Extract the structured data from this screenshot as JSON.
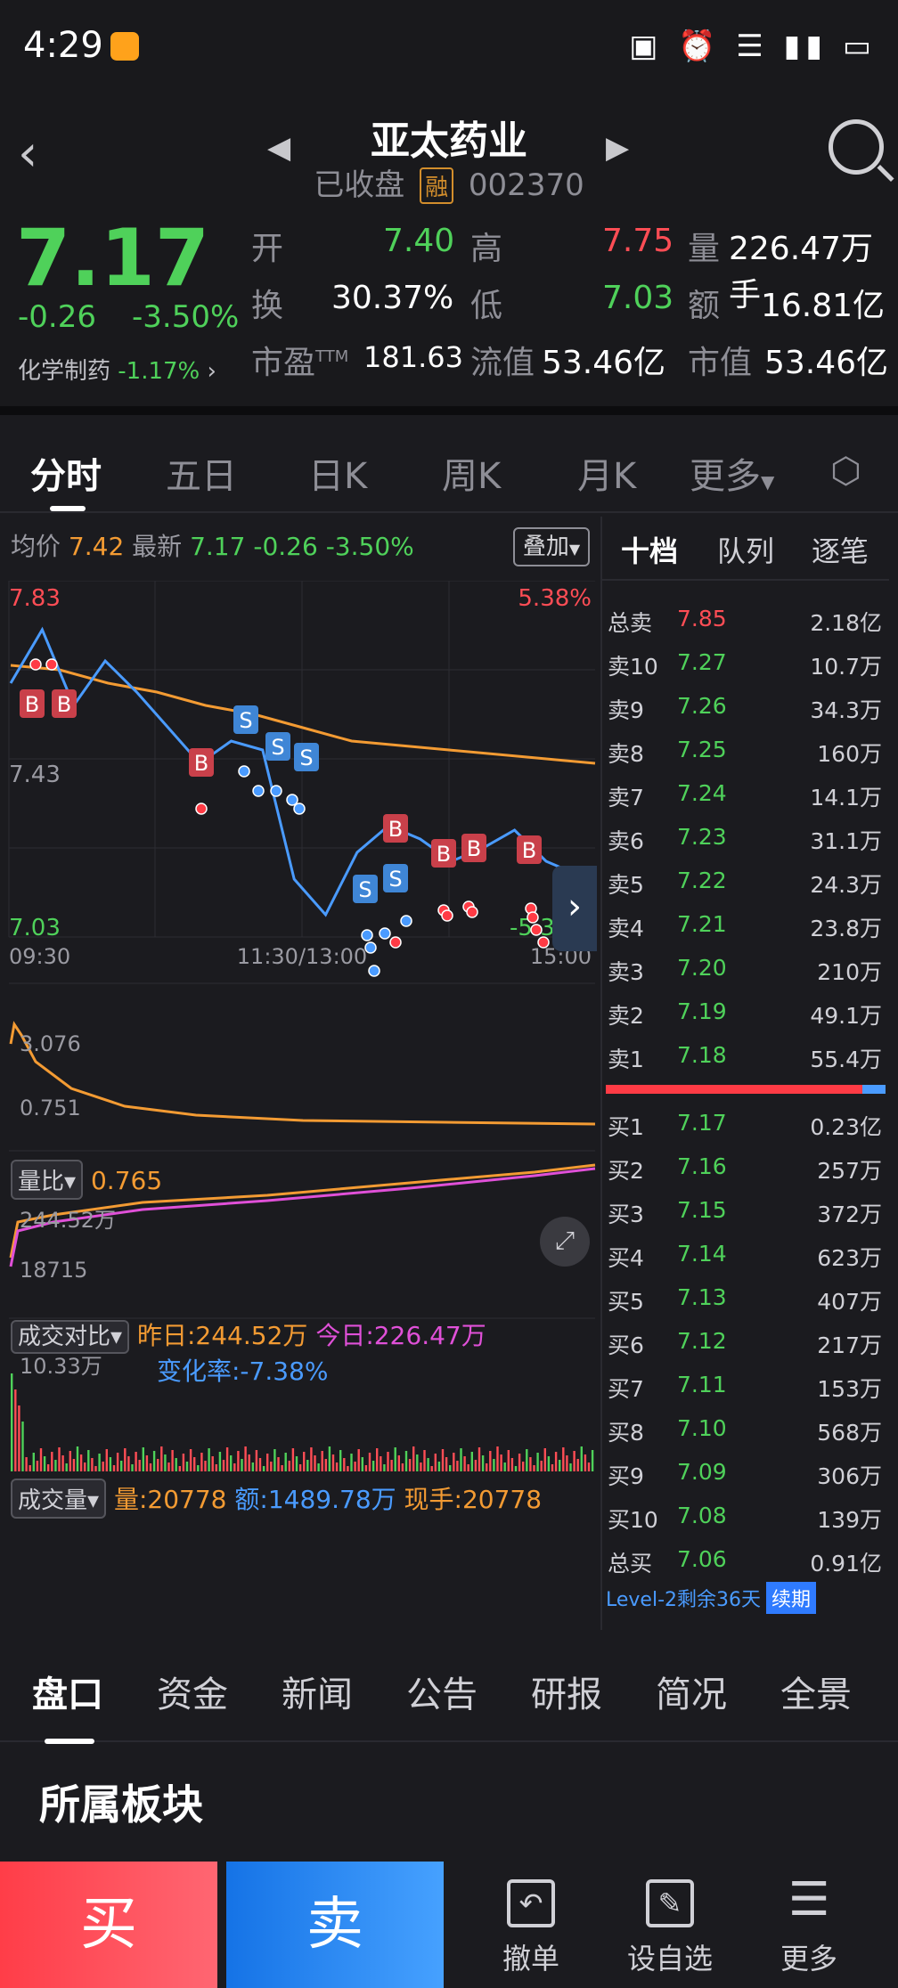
{
  "status": {
    "time": "4:29",
    "battery": "9"
  },
  "header": {
    "title": "亚太药业",
    "state": "已收盘",
    "margin_tag": "融",
    "code": "002370"
  },
  "quote": {
    "price": "7.17",
    "change": "-0.26",
    "change_pct": "-3.50%",
    "sector": "化学制药",
    "sector_pct": "-1.17%",
    "open_label": "开",
    "open": "7.40",
    "high_label": "高",
    "high": "7.75",
    "vol_label": "量",
    "vol": "226.47万手",
    "turnover_label": "换",
    "turnover": "30.37%",
    "low_label": "低",
    "low": "7.03",
    "amount_label": "额",
    "amount": "16.81亿",
    "pe_label": "市盈",
    "pe_sup": "TTM",
    "pe": "181.63",
    "float_label": "流值",
    "float_val": "53.46亿",
    "mcap_label": "市值",
    "mcap": "53.46亿"
  },
  "tabs": [
    "分时",
    "五日",
    "日K",
    "周K",
    "月K",
    "更多"
  ],
  "chart": {
    "avg_label": "均价",
    "avg": "7.42",
    "latest_label": "最新",
    "latest": "7.17",
    "latest_chg": "-0.26",
    "latest_pct": "-3.50%",
    "overlay": "叠加",
    "y_top": "7.83",
    "y_mid": "7.43",
    "y_bot": "7.03",
    "pct_top": "5.38%",
    "pct_bot": "-5.38%",
    "t_start": "09:30",
    "t_mid": "11:30/13:00",
    "t_end": "15:00",
    "vr_label": "量比",
    "vr": "0.765",
    "vr_top": "3.076",
    "vr_bot": "0.751",
    "cmp_label": "成交对比",
    "yest": "昨日:244.52万",
    "today": "今日:226.47万",
    "change_rate": "变化率:-7.38%",
    "cmp_top": "244.52万",
    "cmp_bot": "18715",
    "vol_label": "成交量",
    "vol": "量:20778",
    "amt": "额:1489.78万",
    "cur": "现手:20778",
    "vol_top": "10.33万"
  },
  "chart_data": {
    "type": "line",
    "x": [
      "09:30",
      "11:30/13:00",
      "15:00"
    ],
    "ylim": [
      7.03,
      7.83
    ],
    "series": [
      {
        "name": "均价",
        "values": [
          7.64,
          7.63,
          7.6,
          7.58,
          7.55,
          7.53,
          7.5,
          7.47,
          7.46,
          7.45,
          7.44,
          7.43,
          7.42
        ]
      },
      {
        "name": "最新",
        "values": [
          7.6,
          7.72,
          7.55,
          7.65,
          7.58,
          7.5,
          7.42,
          7.47,
          7.45,
          7.16,
          7.08,
          7.22,
          7.28,
          7.25,
          7.2,
          7.23,
          7.27,
          7.2,
          7.17
        ]
      }
    ]
  },
  "book": {
    "tabs": [
      "十档",
      "队列",
      "逐笔"
    ],
    "sells": [
      {
        "label": "总卖",
        "price": "7.85",
        "vol": "2.18亿"
      },
      {
        "label": "卖10",
        "price": "7.27",
        "vol": "10.7万"
      },
      {
        "label": "卖9",
        "price": "7.26",
        "vol": "34.3万"
      },
      {
        "label": "卖8",
        "price": "7.25",
        "vol": "160万"
      },
      {
        "label": "卖7",
        "price": "7.24",
        "vol": "14.1万"
      },
      {
        "label": "卖6",
        "price": "7.23",
        "vol": "31.1万"
      },
      {
        "label": "卖5",
        "price": "7.22",
        "vol": "24.3万"
      },
      {
        "label": "卖4",
        "price": "7.21",
        "vol": "23.8万"
      },
      {
        "label": "卖3",
        "price": "7.20",
        "vol": "210万"
      },
      {
        "label": "卖2",
        "price": "7.19",
        "vol": "49.1万"
      },
      {
        "label": "卖1",
        "price": "7.18",
        "vol": "55.4万"
      }
    ],
    "buys": [
      {
        "label": "买1",
        "price": "7.17",
        "vol": "0.23亿"
      },
      {
        "label": "买2",
        "price": "7.16",
        "vol": "257万"
      },
      {
        "label": "买3",
        "price": "7.15",
        "vol": "372万"
      },
      {
        "label": "买4",
        "price": "7.14",
        "vol": "623万"
      },
      {
        "label": "买5",
        "price": "7.13",
        "vol": "407万"
      },
      {
        "label": "买6",
        "price": "7.12",
        "vol": "217万"
      },
      {
        "label": "买7",
        "price": "7.11",
        "vol": "153万"
      },
      {
        "label": "买8",
        "price": "7.10",
        "vol": "568万"
      },
      {
        "label": "买9",
        "price": "7.09",
        "vol": "306万"
      },
      {
        "label": "买10",
        "price": "7.08",
        "vol": "139万"
      },
      {
        "label": "总买",
        "price": "7.06",
        "vol": "0.91亿"
      }
    ],
    "level2": "Level-2剩余36天",
    "renew": "续期"
  },
  "bottom_tabs": [
    "盘口",
    "资金",
    "新闻",
    "公告",
    "研报",
    "简况",
    "全景"
  ],
  "board_title": "所属板块",
  "actions": {
    "buy": "买",
    "sell": "卖",
    "cancel": "撤单",
    "watch": "设自选",
    "more": "更多"
  },
  "colors": {
    "up": "#ff4d55",
    "down": "#4fd15a",
    "avg": "#f39b33",
    "line": "#4a9bff"
  }
}
